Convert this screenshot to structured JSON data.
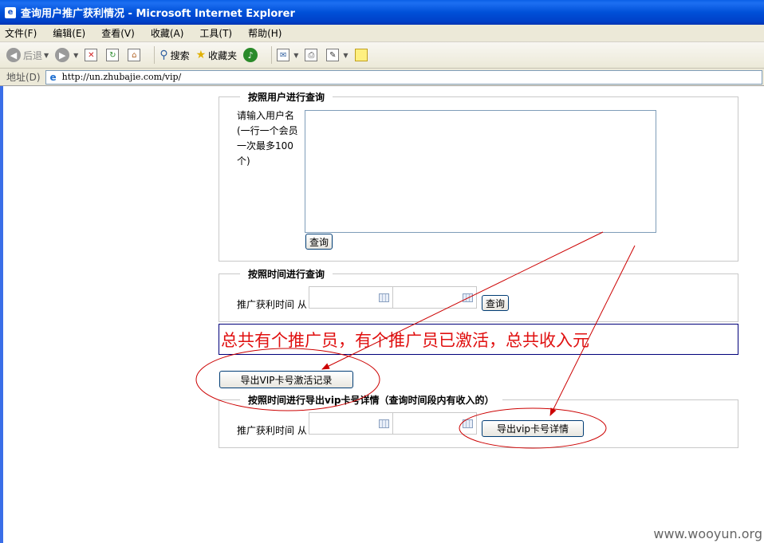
{
  "window": {
    "title": "查询用户推广获利情况 - Microsoft Internet Explorer"
  },
  "menu": [
    "文件(F)",
    "编辑(E)",
    "查看(V)",
    "收藏(A)",
    "工具(T)",
    "帮助(H)"
  ],
  "toolbar": {
    "back": "后退",
    "search": "搜索",
    "favorites": "收藏夹"
  },
  "address": {
    "label": "地址(D)",
    "url": "http://un.zhubajie.com/vip/"
  },
  "user_query": {
    "legend": "按照用户进行查询",
    "prompt_lines": [
      "请输入用户名",
      "(一行一个会员",
      "一次最多100",
      "个)"
    ],
    "textarea_value": "",
    "button": "查询"
  },
  "time_query": {
    "legend": "按照时间进行查询",
    "label": "推广获利时间 从",
    "from_value": "",
    "to_value": "",
    "button": "查询"
  },
  "summary": {
    "text": "总共有个推广员，有个推广员已激活，总共收入元"
  },
  "export_activation": {
    "button": "导出VIP卡号激活记录"
  },
  "export_query": {
    "legend": "按照时间进行导出vip卡号详情（查询时间段内有收入的）",
    "label": "推广获利时间 从",
    "from_value": "",
    "to_value": "",
    "button": "导出vip卡号详情"
  },
  "annotation_color": "#cc0000",
  "watermark": "www.wooyun.org"
}
